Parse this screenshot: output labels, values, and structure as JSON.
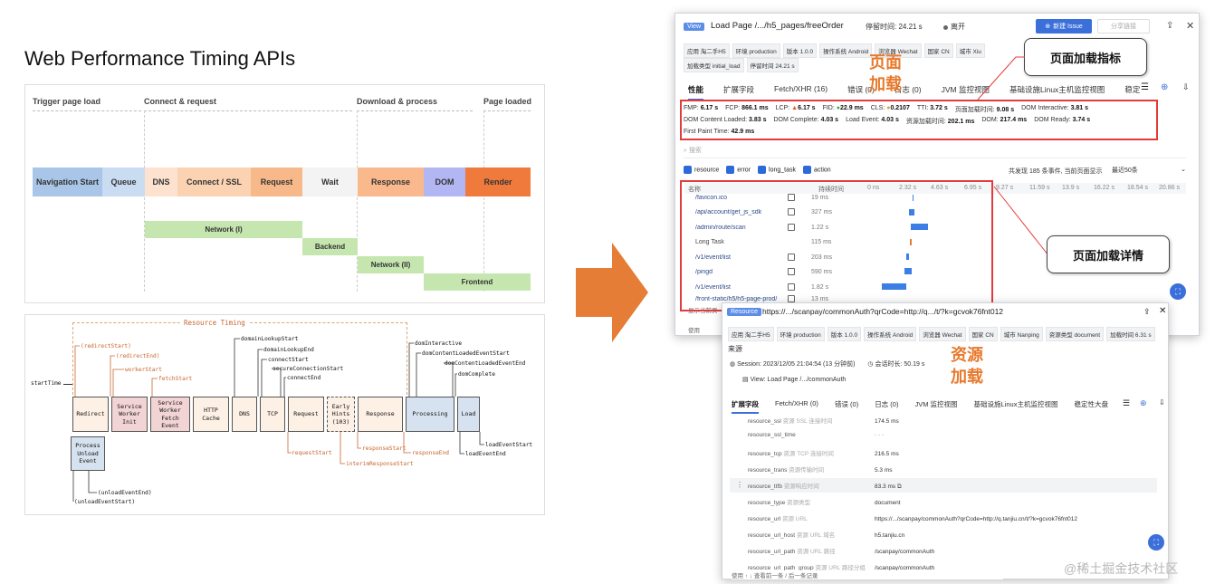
{
  "title": "Web Performance Timing APIs",
  "timing": {
    "phases": [
      "Trigger page load",
      "Connect & request",
      "Download & process",
      "Page loaded"
    ],
    "bars": [
      "Navigation Start",
      "Queue",
      "DNS",
      "Connect / SSL",
      "Request",
      "Wait",
      "Response",
      "DOM",
      "Render"
    ],
    "net": [
      "Network (I)",
      "Backend",
      "Network (II)",
      "Frontend"
    ],
    "colors": {
      "nav": "#a9c5e8",
      "queue": "#c9dcf2",
      "dns": "#fde3cf",
      "connect": "#fbd3b3",
      "request": "#f8b98a",
      "wait": "#f3f3f3",
      "response": "#f9b98c",
      "dom": "#b2b6f2",
      "render": "#f07a3c",
      "net": "#c6e6b0"
    }
  },
  "resource": {
    "title": "Resource Timing",
    "start": "startTime",
    "boxes": [
      "Redirect",
      "Service\nWorker\nInit",
      "Service\nWorker\nFetch\nEvent",
      "HTTP\nCache",
      "DNS",
      "TCP",
      "Request",
      "Early\nHints\n(103)",
      "Response",
      "Processing",
      "Load",
      "Process\nUnload\nEvent"
    ],
    "top_labels": [
      "(redirectStart)",
      "(redirectEnd)",
      "workerStart",
      "fetchStart",
      "domainLookupStart",
      "domainLookupEnd",
      "connectStart",
      "secureConnectionStart",
      "connectEnd",
      "domInteractive",
      "domContentLoadedEventStart",
      "domContentLoadedEventEnd",
      "domComplete"
    ],
    "bottom_labels": [
      "requestStart",
      "interimResponseStart",
      "responseStart",
      "responseEnd",
      "loadEventStart",
      "loadEventEnd",
      "(unloadEventEnd)",
      "(unloadEventStart)"
    ]
  },
  "win1": {
    "view": "View",
    "title": "Load Page  /.../h5_pages/freeOrder",
    "stay": "停留时间:  24.21 s",
    "status": "离开",
    "new_issue": "新建 Issue",
    "share": "分享链接",
    "tags1": [
      "应用  淘二手H5",
      "环境  production",
      "版本  1.0.0",
      "操作系统  Android",
      "浏览器  Wechat",
      "国家  CN",
      "城市  Xiu"
    ],
    "tags2": [
      "加载类型  initial_load",
      "停留时间  24.21 s"
    ],
    "tabs": [
      "性能",
      "扩展字段",
      "Fetch/XHR (16)",
      "错误 (0)",
      "日志 (0)",
      "JVM 监控视图",
      "基础设施Linux主机监控视图",
      "稳定"
    ],
    "metrics1": [
      [
        "FMP:",
        "6.17 s"
      ],
      [
        "FCP:",
        "866.1 ms"
      ],
      [
        "LCP:",
        "6.17 s"
      ],
      [
        "FID:",
        "22.9 ms"
      ],
      [
        "CLS:",
        "0.2107"
      ],
      [
        "TTI:",
        "3.72 s"
      ],
      [
        "页面加载时间:",
        "9.08 s"
      ],
      [
        "DOM Interactive:",
        "3.81 s"
      ]
    ],
    "metrics2": [
      [
        "DOM Content Loaded:",
        "3.83 s"
      ],
      [
        "DOM Complete:",
        "4.03 s"
      ],
      [
        "Load Event:",
        "4.03 s"
      ],
      [
        "资源加载时间:",
        "202.1 ms"
      ],
      [
        "DOM:",
        "217.4 ms"
      ],
      [
        "DOM Ready:",
        "3.74 s"
      ]
    ],
    "metrics3": [
      [
        "First Paint Time:",
        "42.9 ms"
      ]
    ],
    "search": "搜索",
    "filters": [
      "resource",
      "error",
      "long_task",
      "action"
    ],
    "summary": "共发现 185 条事件, 当前页面显示",
    "limit": "最近50条",
    "cols": {
      "name": "名称",
      "dur": "持续时间"
    },
    "ticks": [
      "0 ns",
      "2.32 s",
      "4.63 s",
      "6.95 s",
      "9.27 s",
      "11.59 s",
      "13.9 s",
      "16.22 s",
      "18.54 s",
      "20.86 s"
    ],
    "rows": [
      [
        "/favicon.ico",
        "19 ms"
      ],
      [
        "/api/account/get_js_sdk",
        "327 ms"
      ],
      [
        "/admin/route/scan",
        "1.22 s"
      ],
      [
        "Long Task",
        "115 ms"
      ],
      [
        "/v1/event/list",
        "203 ms"
      ],
      [
        "/pingd",
        "590 ms"
      ],
      [
        "/v1/event/list",
        "1.82 s"
      ],
      [
        "/front-static/h5/h5-page-prod/",
        "13 ms"
      ]
    ],
    "footer": "显示当前页",
    "use": "使用"
  },
  "win2": {
    "resource": "Resource",
    "url": "https://.../scanpay/commonAuth?qrCode=http://q.../t/?k=gcvok76fnt012",
    "tags": [
      "应用  淘二手H5",
      "环境  production",
      "版本  1.0.0",
      "操作系统  Android",
      "浏览器  Wechat",
      "国家  CN",
      "城市  Nanping",
      "资源类型  document",
      "加载时间  6.31 s"
    ],
    "source": "来源",
    "session": "Session:  2023/12/05 21:04:54  (13 分钟前)",
    "dur": "会话时长:  50.19 s",
    "view": "View:  Load Page  /.../commonAuth",
    "tabs": [
      "扩展字段",
      "Fetch/XHR (0)",
      "错误 (0)",
      "日志 (0)",
      "JVM 监控视图",
      "基础设施Linux主机监控视图",
      "稳定性大盘"
    ],
    "kv": [
      [
        "resource_ssl",
        "资源 SSL 连接时间",
        "174.5 ms"
      ],
      [
        "resource_ssl_time",
        "",
        "- - -"
      ],
      [
        "resource_tcp",
        "资源 TCP 连接时间",
        "216.5 ms"
      ],
      [
        "resource_trans",
        "资源传输时间",
        "5.3 ms"
      ],
      [
        "resource_ttfb",
        "资源响应时间",
        "83.3 ms"
      ],
      [
        "resource_type",
        "资源类型",
        "document"
      ],
      [
        "resource_url",
        "资源 URL",
        "https://.../scanpay/commonAuth?qrCode=http://q.tanjiu.cn/t/?k=gcvok76fnt012"
      ],
      [
        "resource_url_host",
        "资源 URL 域名",
        "h5.tanjiu.cn"
      ],
      [
        "resource_url_path",
        "资源 URL 路径",
        "/scanpay/commonAuth"
      ],
      [
        "resource_url_path_group",
        "资源 URL 路径分组",
        "/scanpay/commonAuth"
      ]
    ],
    "footer": "使用  ↑  ↓  查看前一条 / 后一条记录"
  },
  "callouts": {
    "metrics": "页面加载指标",
    "detail": "页面加载详情"
  },
  "orange": {
    "page": "页面",
    "load": "加载",
    "res": "资源",
    "res_load": "加载"
  },
  "watermark": "@稀土掘金技术社区"
}
